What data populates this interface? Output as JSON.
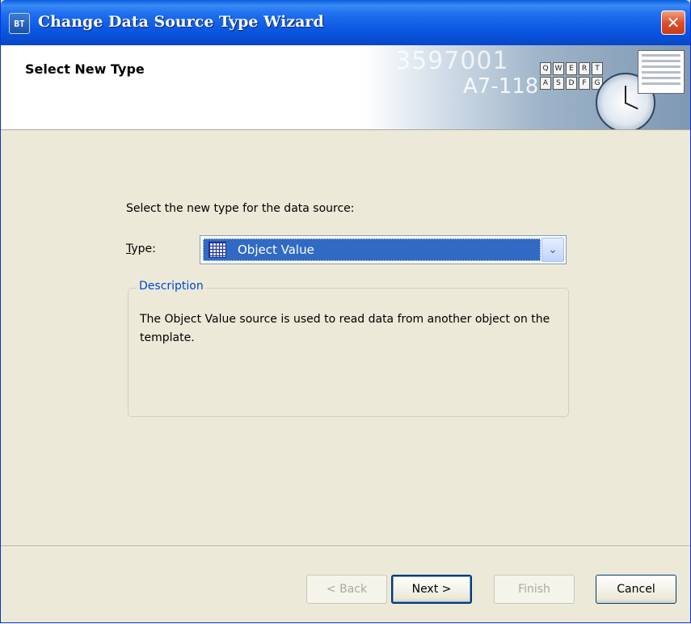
{
  "window": {
    "title": "Change Data Source Type Wizard",
    "title_icon": "BT",
    "close_glyph": "✕"
  },
  "header": {
    "title": "Select New Type",
    "art_number1": "3597001",
    "art_number2": "A7-118",
    "keys_row1": [
      "Q",
      "W",
      "E",
      "R",
      "T"
    ],
    "keys_row2": [
      "A",
      "S",
      "D",
      "F",
      "G"
    ]
  },
  "main": {
    "prompt": "Select the new type for the data source:",
    "type_label_underlined": "T",
    "type_label_rest": "ype:",
    "type_selected": "Object Value",
    "dropdown_arrow": "⌄",
    "description_legend": "Description",
    "description_text": "The Object Value source is used to read data from another object on the template."
  },
  "buttons": {
    "back": "< Back",
    "next": "Next >",
    "finish": "Finish",
    "cancel": "Cancel"
  },
  "colors": {
    "titlebar": "#0a55e0",
    "selection": "#316ac5",
    "legend": "#0046d5",
    "dialog_bg": "#ece9d8"
  }
}
